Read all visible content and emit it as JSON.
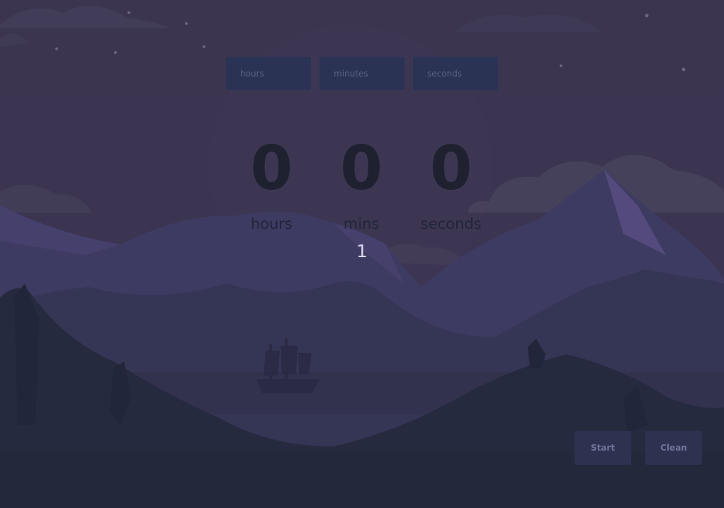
{
  "inputs": {
    "hours_placeholder": "hours",
    "minutes_placeholder": "minutes",
    "seconds_placeholder": "seconds"
  },
  "timer": {
    "hours_value": "0",
    "hours_label": "hours",
    "mins_value": "0",
    "mins_label": "mins",
    "seconds_value": "0",
    "seconds_label": "seconds"
  },
  "counter": "1",
  "buttons": {
    "start_label": "Start",
    "clean_label": "Clean"
  },
  "colors": {
    "sky": "#3b3551",
    "mountain": "#3f3d65",
    "foreground": "#23283a",
    "input_bg": "#2b3355",
    "button_bg": "#2e3150"
  }
}
